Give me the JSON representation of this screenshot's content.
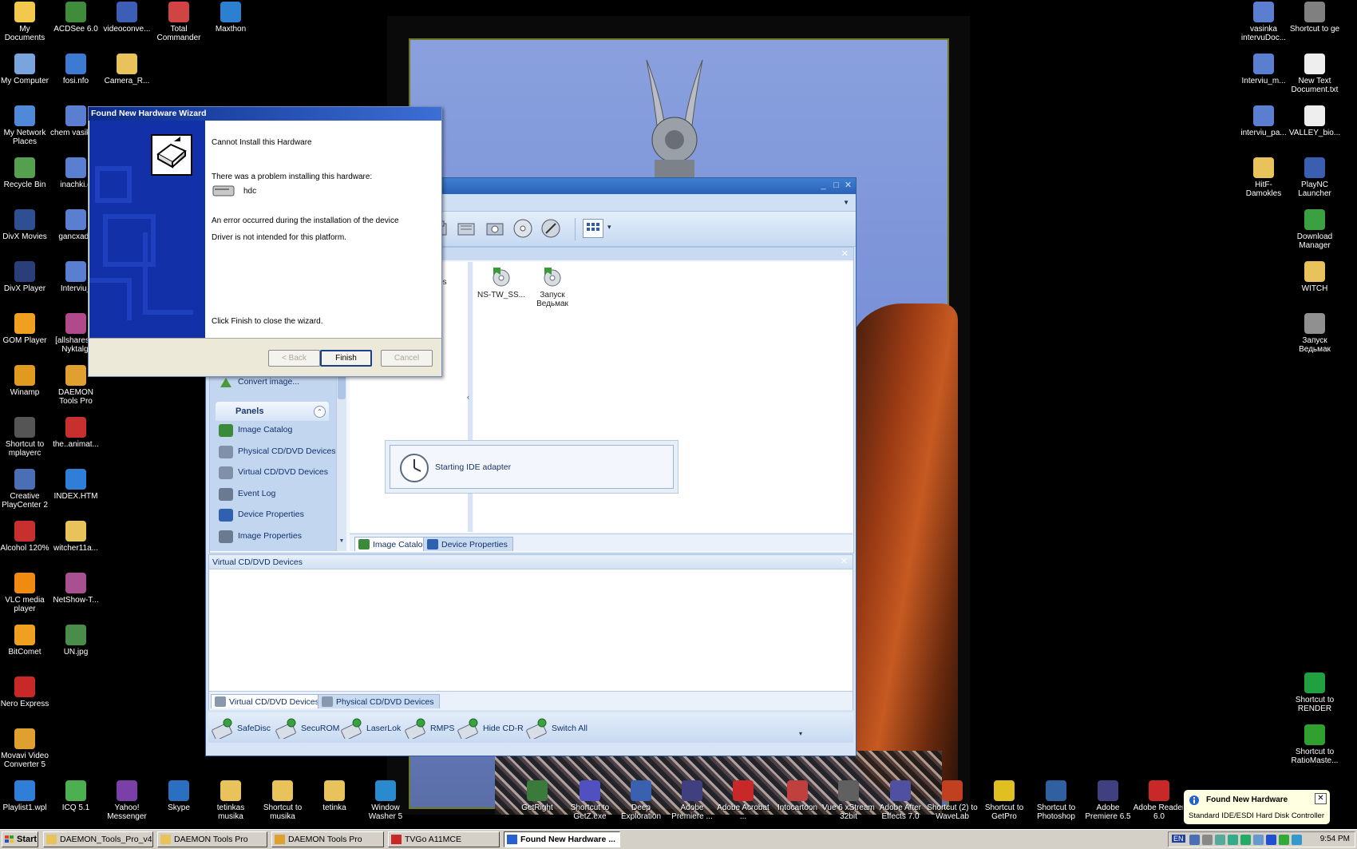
{
  "desktop": {
    "left_icons": [
      {
        "label": "My Documents",
        "color": "#f2c94c"
      },
      {
        "label": "ACDSee 6.0",
        "color": "#3f8c3a"
      },
      {
        "label": "videoconve...",
        "color": "#3c5fb5"
      },
      {
        "label": "Total Commander",
        "color": "#d04444"
      },
      {
        "label": "Maxthon",
        "color": "#2d7fd0"
      },
      {
        "label": "My Computer",
        "color": "#7aa5dc"
      },
      {
        "label": "fosi.nfo",
        "color": "#3d7ad1"
      },
      {
        "label": "Camera_R...",
        "color": "#e8c35c"
      },
      {
        "label": "My Network Places",
        "color": "#4f89d8"
      },
      {
        "label": "chem vasiko.d",
        "color": "#5b7fd0"
      },
      {
        "label": "Recycle Bin",
        "color": "#55a04e"
      },
      {
        "label": "inachki.d",
        "color": "#5b7fd0"
      },
      {
        "label": "DivX Movies",
        "color": "#2e4f91"
      },
      {
        "label": "gancxade",
        "color": "#5b7fd0"
      },
      {
        "label": "DivX Player",
        "color": "#2a3f7a"
      },
      {
        "label": "Interviu_",
        "color": "#5b7fd0"
      },
      {
        "label": "GOM Player",
        "color": "#f0a020"
      },
      {
        "label": "[allshares] - Nyktalgi",
        "color": "#b04a8a"
      },
      {
        "label": "Winamp",
        "color": "#e09a20"
      },
      {
        "label": "DAEMON Tools Pro",
        "color": "#e0a030"
      },
      {
        "label": "Shortcut to mplayerc",
        "color": "#555"
      },
      {
        "label": "the..animat...",
        "color": "#c83030"
      },
      {
        "label": "Creative PlayCenter 2",
        "color": "#4a6fb5"
      },
      {
        "label": "INDEX.HTM",
        "color": "#2f7fd8"
      },
      {
        "label": "Alcohol 120%",
        "color": "#c83030"
      },
      {
        "label": "witcher11a...",
        "color": "#e8c35c"
      },
      {
        "label": "VLC media player",
        "color": "#f08a10"
      },
      {
        "label": "NetShow-T...",
        "color": "#a85090"
      },
      {
        "label": "BitComet",
        "color": "#f0a020"
      },
      {
        "label": "UN.jpg",
        "color": "#4a8c4a"
      },
      {
        "label": "Nero Express",
        "color": "#c82828"
      },
      {
        "label": "Movavi Video Converter 5",
        "color": "#e0a030"
      },
      {
        "label": "Playlist1.wpl",
        "color": "#2f7fd8"
      },
      {
        "label": "ICQ 5.1",
        "color": "#4caf50"
      },
      {
        "label": "Yahoo! Messenger",
        "color": "#7b3fa8"
      },
      {
        "label": "Skype",
        "color": "#2a6fc0"
      },
      {
        "label": "tetinkas musika",
        "color": "#e8c35c"
      },
      {
        "label": "Shortcut to musika",
        "color": "#e8c35c"
      },
      {
        "label": "tetinka",
        "color": "#e8c35c"
      },
      {
        "label": "Window Washer 5",
        "color": "#2a8ad0"
      },
      {
        "label": "GetRight",
        "color": "#3a7a3a"
      },
      {
        "label": "Shortcut to GetZ.exe",
        "color": "#5050c0"
      },
      {
        "label": "Deep Exploration",
        "color": "#3a60b0"
      },
      {
        "label": "Adobe Premiere ...",
        "color": "#404080"
      },
      {
        "label": "Adobe Acrobat ...",
        "color": "#c82828"
      },
      {
        "label": "Intocartoon",
        "color": "#c04040"
      },
      {
        "label": "Vue 6 xStream 32bit",
        "color": "#606060"
      },
      {
        "label": "Adobe After Effects 7.0",
        "color": "#5050a0"
      },
      {
        "label": "Shortcut (2) to WaveLab",
        "color": "#c04020"
      },
      {
        "label": "Shortcut to GetPro",
        "color": "#e0c020"
      },
      {
        "label": "Shortcut to Photoshop",
        "color": "#3060a0"
      },
      {
        "label": "Adobe Premiere 6.5",
        "color": "#404080"
      },
      {
        "label": "Adobe Reader 6.0",
        "color": "#c82828"
      }
    ],
    "right_icons": [
      {
        "label": "vasinka intervuDoc...",
        "color": "#5b7fd0"
      },
      {
        "label": "Shortcut to ge",
        "color": "#808080"
      },
      {
        "label": "Interviu_m...",
        "color": "#5b7fd0"
      },
      {
        "label": "New Text Document.txt",
        "color": "#eeeeee"
      },
      {
        "label": "interviu_pa...",
        "color": "#5b7fd0"
      },
      {
        "label": "VALLEY_bio...",
        "color": "#eeeeee"
      },
      {
        "label": "HitF-Damokles",
        "color": "#e8c35c"
      },
      {
        "label": "PlayNC Launcher",
        "color": "#3a5fb0"
      },
      {
        "label": "Download Manager",
        "color": "#3aa040"
      },
      {
        "label": "WITCH",
        "color": "#e8c35c"
      },
      {
        "label": "Запуск Ведьмак",
        "color": "#909090"
      },
      {
        "label": "Shortcut to RENDER",
        "color": "#20a040"
      },
      {
        "label": "Shortcut to RatioMaste...",
        "color": "#30a030"
      }
    ]
  },
  "daemon_window": {
    "title": "DAEMON Tools Pro",
    "panels_label": "Panels",
    "convert_label": "Convert image...",
    "panel_items": [
      {
        "label": "Image Catalog"
      },
      {
        "label": "Physical CD/DVD Devices"
      },
      {
        "label": "Virtual CD/DVD Devices"
      },
      {
        "label": "Event Log"
      },
      {
        "label": "Device Properties"
      },
      {
        "label": "Image Properties"
      }
    ],
    "tree_partial_text": "ages",
    "catalog_items": [
      {
        "label": "NS-TW_SS..."
      },
      {
        "label": "Запуск Ведьмак"
      }
    ],
    "progress_text": "Starting IDE adapter",
    "upper_tabs": [
      {
        "label": "Image Catalog",
        "active": true
      },
      {
        "label": "Device Properties",
        "active": false
      }
    ],
    "lower_title": "Virtual CD/DVD Devices",
    "lower_tabs": [
      {
        "label": "Virtual CD/DVD Devices",
        "active": true
      },
      {
        "label": "Physical CD/DVD Devices",
        "active": false
      }
    ],
    "emulation_buttons": [
      {
        "label": "SafeDisc"
      },
      {
        "label": "SecuROM"
      },
      {
        "label": "LaserLok"
      },
      {
        "label": "RMPS"
      },
      {
        "label": "Hide CD-R"
      },
      {
        "label": "Switch All"
      }
    ]
  },
  "wizard": {
    "title": "Found New Hardware Wizard",
    "heading": "Cannot Install this Hardware",
    "problem_text": "There was a problem installing this hardware:",
    "device_name": "hdc",
    "error_text": "An error occurred during the installation of the device",
    "reason_text": "Driver is not intended for this platform.",
    "finish_hint": "Click Finish to close the wizard.",
    "back_label": "< Back",
    "finish_label": "Finish",
    "cancel_label": "Cancel"
  },
  "taskbar": {
    "start_label": "Start",
    "tasks": [
      {
        "label": "DAEMON_Tools_Pro_v4....",
        "active": false
      },
      {
        "label": "DAEMON Tools Pro",
        "active": false
      },
      {
        "label": "DAEMON Tools Pro",
        "active": false
      },
      {
        "label": "TVGo A11MCE",
        "active": false
      },
      {
        "label": "Found New Hardware ...",
        "active": true
      }
    ],
    "language": "EN",
    "clock": "9:54 PM"
  },
  "balloon": {
    "title": "Found New Hardware",
    "text": "Standard IDE/ESDI Hard Disk Controller"
  }
}
